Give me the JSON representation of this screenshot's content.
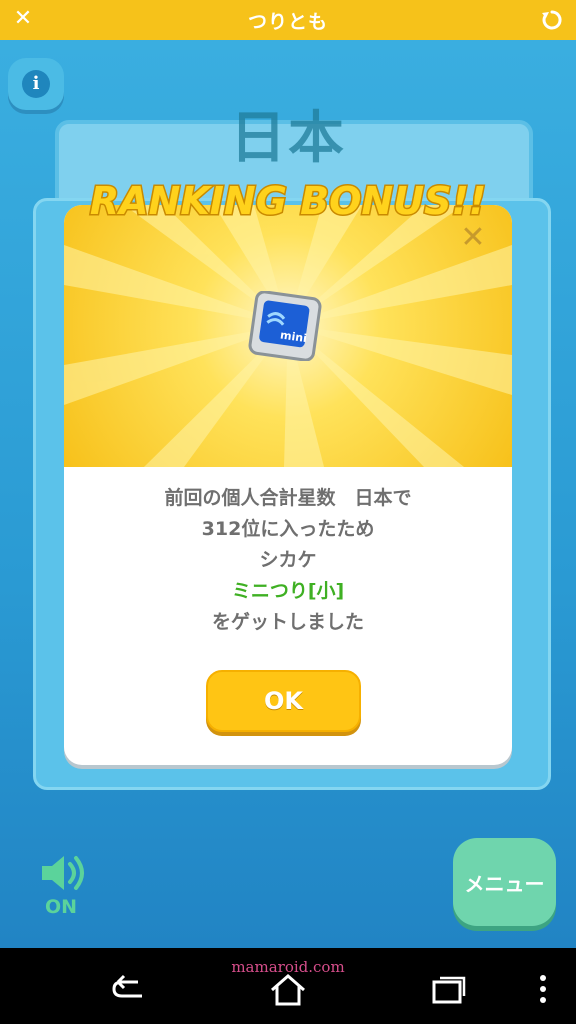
{
  "header": {
    "title": "つりとも"
  },
  "scene": {
    "country_label": "日本",
    "sound_status": "ON",
    "menu_label": "メニュー"
  },
  "dialog": {
    "banner": "RANKING BONUS!!",
    "item_badge": "mini",
    "message_lines": [
      "前回の個人合計星数　日本で",
      "312位に入ったため",
      "シカケ"
    ],
    "item_name": "ミニつり[小]",
    "closing_line": "をゲットしました",
    "ok_label": "OK"
  },
  "watermark": "mamaroid.com",
  "colors": {
    "accent_yellow": "#f6c21a",
    "ocean_blue": "#2f9fd3",
    "item_green": "#3fb023"
  }
}
